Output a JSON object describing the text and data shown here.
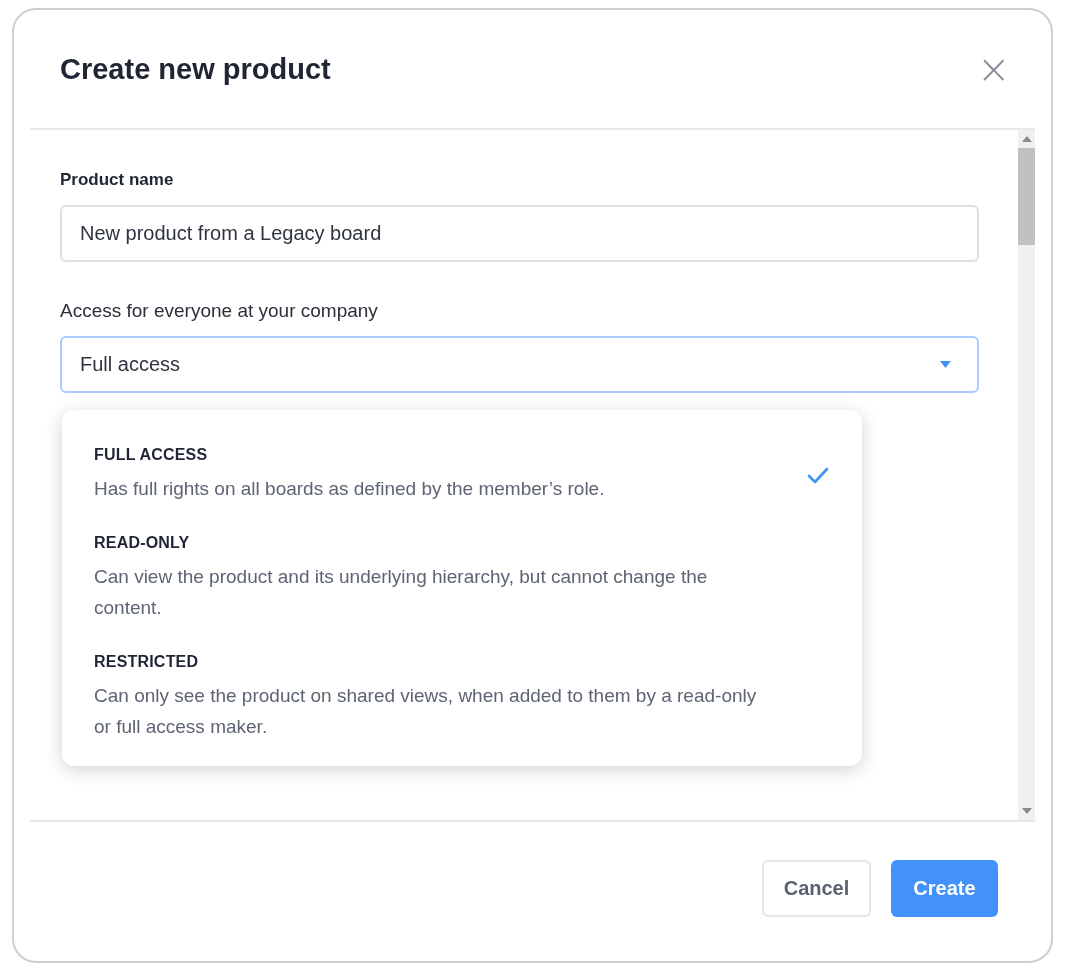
{
  "dialog": {
    "title": "Create new product",
    "close": "×"
  },
  "product_name": {
    "label": "Product name",
    "value": "New product from a Legacy board"
  },
  "access": {
    "label": "Access for everyone at your company",
    "value": "Full access",
    "expanded": true,
    "options": [
      {
        "title": "FULL ACCESS",
        "description": "Has full rights on all boards as defined by the member’s role.",
        "selected": true
      },
      {
        "title": "READ-ONLY",
        "description": "Can view the product and its underlying hierarchy, but cannot change the content.",
        "selected": false
      },
      {
        "title": "RESTRICTED",
        "description": "Can only see the product on shared views, when added to them by a read-only or full access maker.",
        "selected": false
      }
    ]
  },
  "buttons": [
    {
      "label": "Cancel",
      "kind": "secondary"
    },
    {
      "label": "Create",
      "kind": "primary"
    }
  ]
}
